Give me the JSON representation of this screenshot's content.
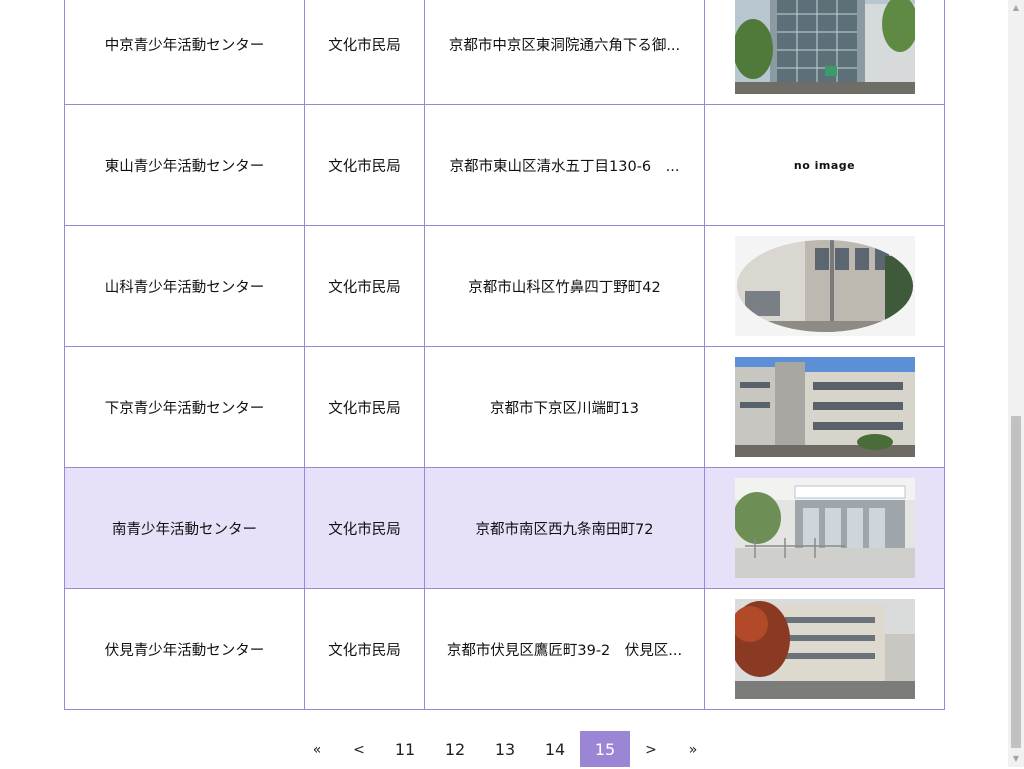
{
  "rows": [
    {
      "name": "中京青少年活動センター",
      "department": "文化市民局",
      "address": "京都市中京区東洞院通六角下る御...",
      "image": "building-photo-nakagyo",
      "highlight": false
    },
    {
      "name": "東山青少年活動センター",
      "department": "文化市民局",
      "address": "京都市東山区清水五丁目130-6　...",
      "image": "no image",
      "highlight": false
    },
    {
      "name": "山科青少年活動センター",
      "department": "文化市民局",
      "address": "京都市山科区竹鼻四丁野町42",
      "image": "building-photo-yamashina",
      "highlight": false
    },
    {
      "name": "下京青少年活動センター",
      "department": "文化市民局",
      "address": "京都市下京区川端町13",
      "image": "building-photo-shimogyo",
      "highlight": false
    },
    {
      "name": "南青少年活動センター",
      "department": "文化市民局",
      "address": "京都市南区西九条南田町72",
      "image": "building-photo-minami",
      "highlight": true
    },
    {
      "name": "伏見青少年活動センター",
      "department": "文化市民局",
      "address": "京都市伏見区鷹匠町39-2　伏見区...",
      "image": "building-photo-fushimi",
      "highlight": false
    }
  ],
  "no_image_label": "no image",
  "pagination": {
    "first": "«",
    "prev": "<",
    "pages": [
      "11",
      "12",
      "13",
      "14",
      "15"
    ],
    "current": "15",
    "next": ">",
    "last": "»"
  },
  "colors": {
    "accent": "#9b86d6",
    "highlight_row": "#e6e0f8"
  }
}
